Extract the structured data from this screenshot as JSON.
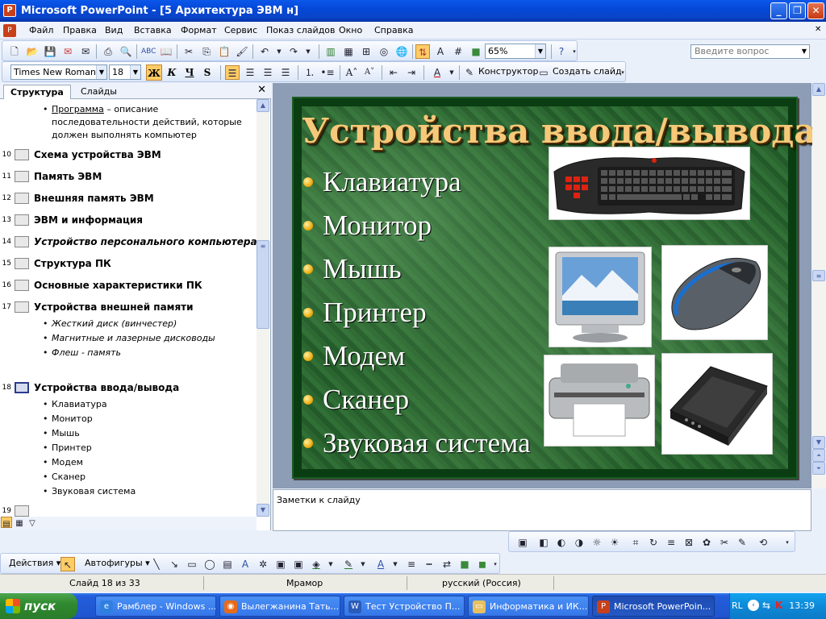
{
  "window": {
    "title": "Microsoft PowerPoint - [5 Архитектура ЭВМ н]",
    "app_icon": "P",
    "buttons": [
      "_",
      "❐",
      "✕"
    ]
  },
  "menu": {
    "items": [
      "Файл",
      "Правка",
      "Вид",
      "Вставка",
      "Формат",
      "Сервис",
      "Показ слайдов",
      "Окно",
      "Справка"
    ],
    "help_placeholder": "Введите вопрос",
    "doc_close": "✕"
  },
  "toolbar_standard": {
    "zoom": "65%"
  },
  "toolbar_format": {
    "font": "Times New Roman",
    "size": "18",
    "bold": "Ж",
    "italic": "К",
    "underline": "Ч",
    "shadow": "S",
    "designer": "Конструктор",
    "new_slide": "Создать слайд"
  },
  "outline": {
    "tab_structure": "Структура",
    "tab_slides": "Слайды",
    "close": "✕",
    "intro_line1a": "Программа",
    "intro_line1b": " – описание",
    "intro_line2": "последовательности действий, которые",
    "intro_line3": "должен выполнять компьютер",
    "slides": [
      {
        "num": "10",
        "title": "Схема устройства ЭВМ"
      },
      {
        "num": "11",
        "title": "Память ЭВМ"
      },
      {
        "num": "12",
        "title": "Внешняя память ЭВМ"
      },
      {
        "num": "13",
        "title": "ЭВМ и информация"
      },
      {
        "num": "14",
        "title": "Устройство персонального компьютера"
      },
      {
        "num": "15",
        "title": "Структура ПК"
      },
      {
        "num": "16",
        "title": "Основные характеристики  ПК"
      },
      {
        "num": "17",
        "title": "Устройства внешней памяти"
      },
      {
        "num": "18",
        "title": "Устройства ввода/вывода"
      },
      {
        "num": "19",
        "title": ""
      }
    ],
    "s17_bullets": [
      "Жесткий диск (винчестер)",
      "Магнитные и лазерные дисководы",
      "Флеш - память"
    ],
    "s18_bullets": [
      "Клавиатура",
      "Монитор",
      "Мышь",
      "Принтер",
      "Модем",
      "Сканер",
      "Звуковая система"
    ]
  },
  "slide": {
    "title": "Устройства ввода/вывода",
    "bullets": [
      "Клавиатура",
      "Монитор",
      "Мышь",
      "Принтер",
      "Модем",
      "Сканер",
      "Звуковая система"
    ]
  },
  "notes": {
    "placeholder": "Заметки к слайду"
  },
  "drawing_toolbar": {
    "actions": "Действия",
    "autoshapes": "Автофигуры"
  },
  "status": {
    "slide": "Слайд 18 из 33",
    "design": "Мрамор",
    "language": "русский (Россия)"
  },
  "taskbar": {
    "start": "пуск",
    "tasks": [
      {
        "label": "Рамблер - Windows ...",
        "icon_color": "#2f7fe0",
        "icon": "e"
      },
      {
        "label": "Вылегжанина Тать...",
        "icon_color": "#e86a1a",
        "icon": "◉"
      },
      {
        "label": "Тест Устройство П...",
        "icon_color": "#2b5bb8",
        "icon": "W"
      },
      {
        "label": "Информатика и ИК...",
        "icon_color": "#e8c060",
        "icon": "▭"
      },
      {
        "label": "Microsoft PowerPoin...",
        "icon_color": "#c8401a",
        "icon": "P"
      }
    ],
    "lang": "RL",
    "clock": "13:39"
  }
}
